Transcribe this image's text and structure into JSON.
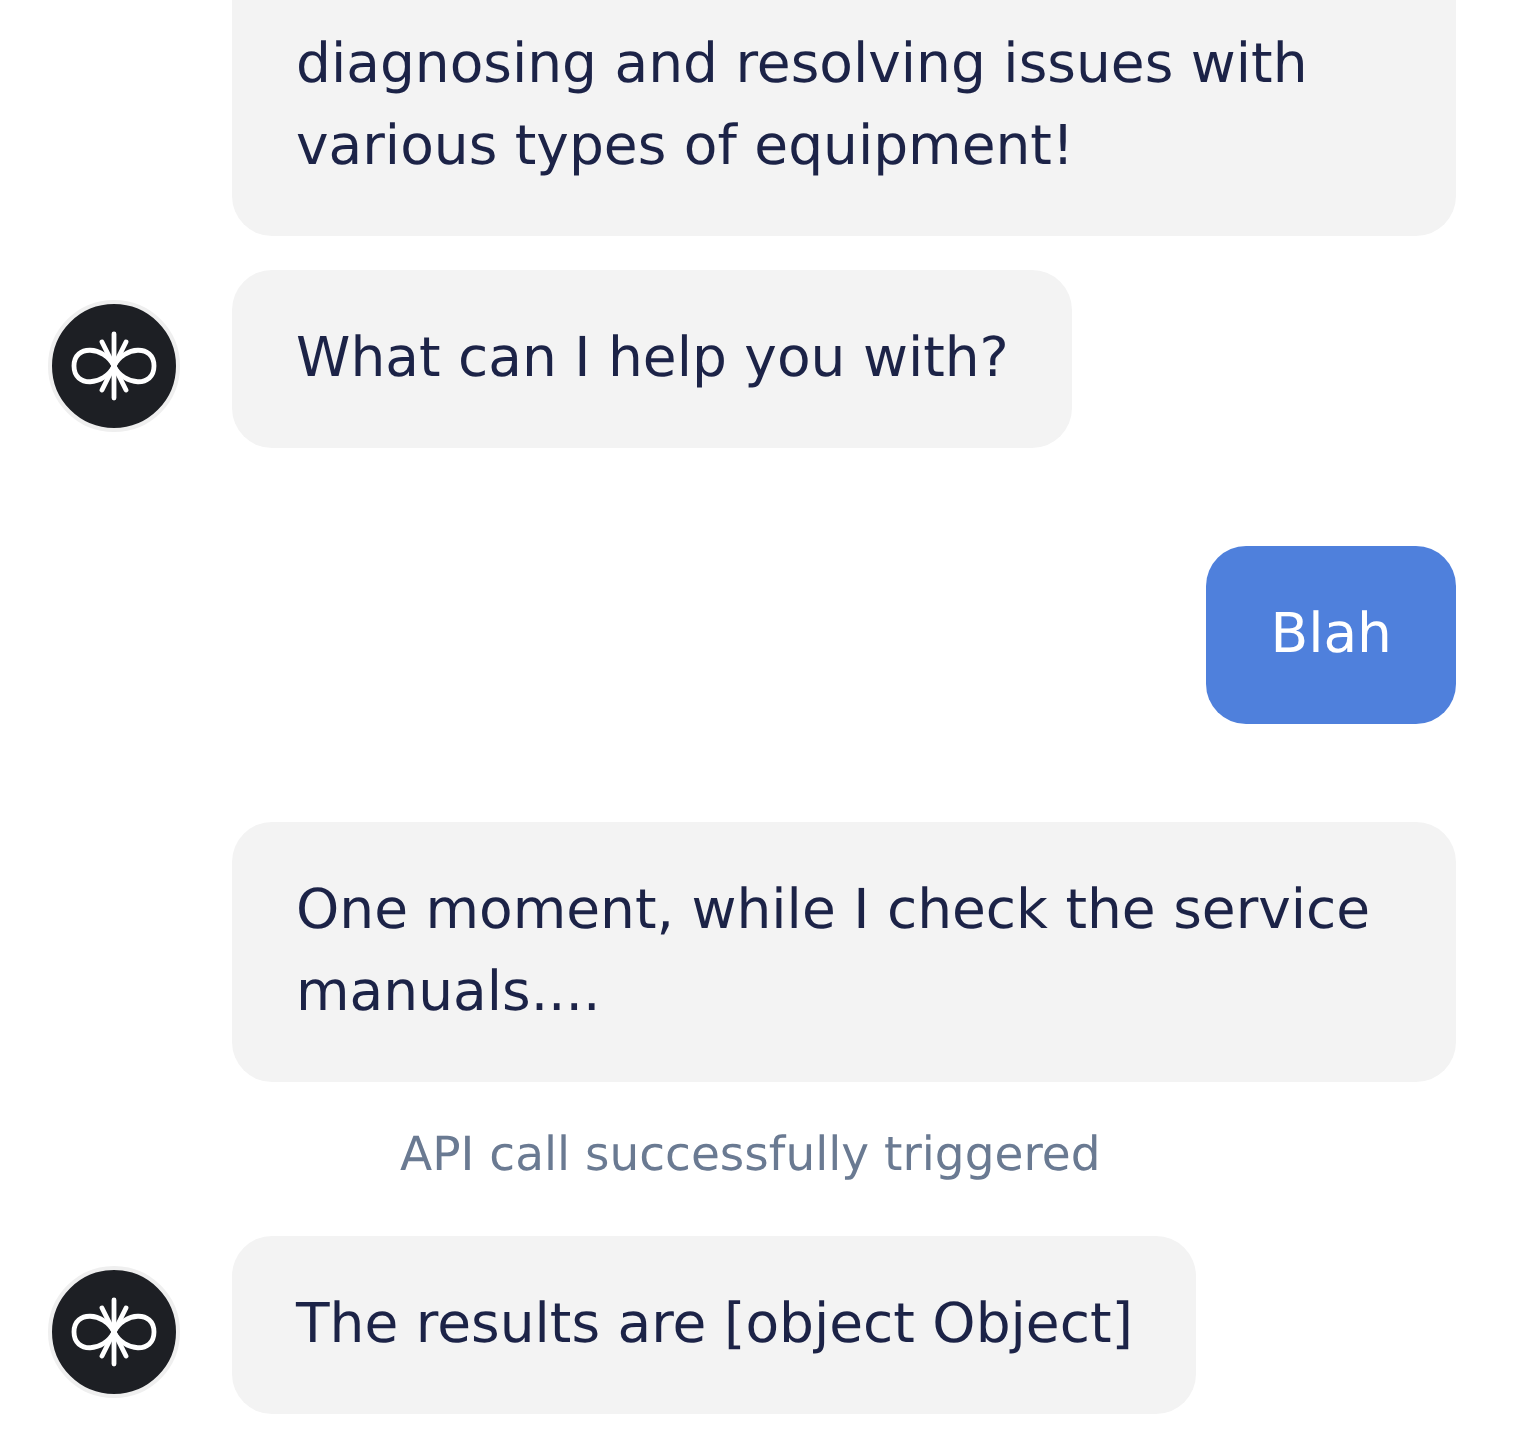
{
  "messages": [
    {
      "kind": "bot",
      "avatar": false,
      "text": "diagnosing and resolving issues with various types of equipment!"
    },
    {
      "kind": "bot",
      "avatar": true,
      "text": "What can I help you with?"
    },
    {
      "kind": "user",
      "text": "Blah"
    },
    {
      "kind": "bot",
      "avatar": false,
      "text": "One moment, while I check the service manuals...."
    },
    {
      "kind": "status",
      "text": "API call successfully triggered"
    },
    {
      "kind": "bot",
      "avatar": true,
      "text": "The results are [object Object]"
    }
  ]
}
